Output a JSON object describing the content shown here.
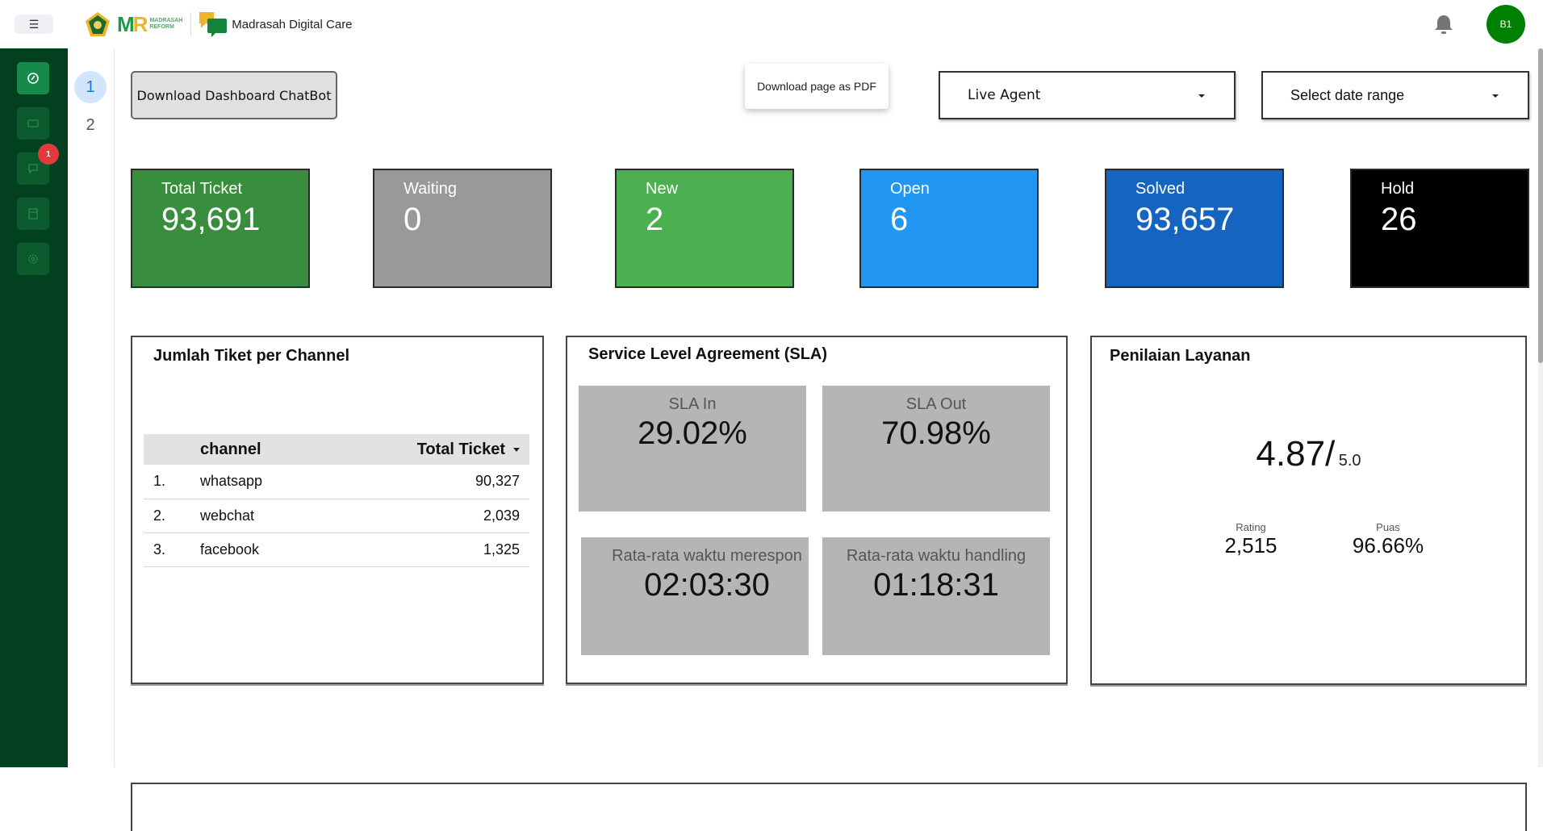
{
  "header": {
    "menu_icon": "hamburger-icon",
    "emblem_icon": "kemenag-emblem-icon",
    "mr_letters_m": "M",
    "mr_letters_r": "R",
    "mr_text_1": "MADRASAH",
    "mr_text_2": "REFORM",
    "brand_name": "Madrasah Digital Care",
    "notification_icon": "bell-icon",
    "avatar_initials": "B1"
  },
  "sidebar": {
    "items": [
      {
        "name": "dashboard",
        "icon": "gauge-icon",
        "active": true
      },
      {
        "name": "tickets",
        "icon": "ticket-icon",
        "active": false
      },
      {
        "name": "chat",
        "icon": "chat-bubbles-icon",
        "active": false,
        "badge": "1"
      },
      {
        "name": "reports",
        "icon": "receipt-icon",
        "active": false
      },
      {
        "name": "settings",
        "icon": "gear-icon",
        "active": false
      }
    ]
  },
  "pages": {
    "items": [
      "1",
      "2"
    ],
    "current": "1"
  },
  "toolbar": {
    "download_button": "Download Dashboard ChatBot",
    "pdf_tooltip": "Download page as PDF",
    "agent_select": "Live Agent",
    "date_select": "Select date range"
  },
  "kpis": [
    {
      "label": "Total Ticket",
      "value": "93,691",
      "color": "#388e3c"
    },
    {
      "label": "Waiting",
      "value": "0",
      "color": "#999999"
    },
    {
      "label": "New",
      "value": "2",
      "color": "#4caf50"
    },
    {
      "label": "Open",
      "value": "6",
      "color": "#2196f3"
    },
    {
      "label": "Solved",
      "value": "93,657",
      "color": "#1565c0"
    },
    {
      "label": "Hold",
      "value": "26",
      "color": "#000000"
    }
  ],
  "channel_panel": {
    "title": "Jumlah Tiket per Channel",
    "columns": [
      "",
      "channel",
      "Total Ticket"
    ],
    "rows": [
      {
        "rank": "1.",
        "channel": "whatsapp",
        "total": "90,327"
      },
      {
        "rank": "2.",
        "channel": "webchat",
        "total": "2,039"
      },
      {
        "rank": "3.",
        "channel": "facebook",
        "total": "1,325"
      }
    ]
  },
  "sla_panel": {
    "title": "Service Level Agreement (SLA)",
    "boxes": [
      {
        "label": "SLA In",
        "value": "29.02%"
      },
      {
        "label": "SLA Out",
        "value": "70.98%"
      },
      {
        "label": "Rata-rata waktu merespon",
        "value": "02:03:30"
      },
      {
        "label": "Rata-rata waktu handling",
        "value": "01:18:31"
      }
    ]
  },
  "rating_panel": {
    "title": "Penilaian Layanan",
    "score": "4.87/",
    "max": "5.0",
    "stats": [
      {
        "label": "Rating",
        "value": "2,515"
      },
      {
        "label": "Puas",
        "value": "96.66%"
      }
    ]
  }
}
